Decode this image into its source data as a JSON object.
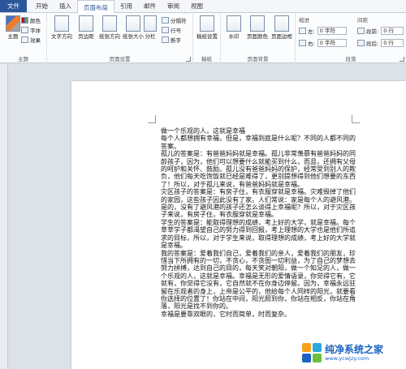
{
  "tabs": [
    "文件",
    "开始",
    "插入",
    "页面布局",
    "引用",
    "邮件",
    "审阅",
    "视图"
  ],
  "ribbon": {
    "theme_group": {
      "label": "主题",
      "theme_button": "主题",
      "colors": "颜色",
      "fonts": "字体",
      "effects": "效果"
    },
    "page_setup": {
      "label": "页面设置",
      "text_direction": "文字方向",
      "margins": "页边距",
      "orientation": "纸张方向",
      "size": "纸张大小",
      "columns": "分栏",
      "breaks": "分隔符",
      "line_numbers": "行号",
      "hyphenation": "断字"
    },
    "draft": {
      "label": "稿纸",
      "draft_settings": "稿纸设置"
    },
    "page_background": {
      "label": "页面背景",
      "watermark": "水印",
      "page_color": "页面颜色",
      "page_borders": "页面边框"
    },
    "paragraph": {
      "label": "段落",
      "indent_title": "缩进",
      "spacing_title": "间距",
      "left_label": "左:",
      "left_value": "0 字符",
      "right_label": "右:",
      "right_value": "0 字符",
      "before_label": "段前:",
      "before_value": "0 行",
      "after_label": "段后:",
      "after_value": "0 行"
    }
  },
  "document": {
    "paragraphs": [
      "做一个乐观的人，这就是幸福",
      "每个人都想拥有幸福，但是，幸福到底是什么呢？不同的人都不同的答案。",
      "孤儿的答案是：有爸爸妈妈就是幸福。孤儿非常羡慕有爸爸妈妈的同龄孩子，因为，他们可以想要什么就能买到什么，而且，还拥有父母的呵护和关怀、鼓励。孤儿没有爸爸妈妈的保护，经常受到别人的欺负，他们每天吃饱饭就已经是难得了，更别提想得到他们想要的东西了！所以，对于孤儿来说，有爸爸妈妈就是幸福。",
      "灾区孩子的答案是：有房子住，有衣服穿就是幸福。灾难毁掉了他们的家园，这些孩子因此没有了家。人们常说：家是每个人的避风港。是的，没有了避风港的孩子还怎么谈得上幸福呢？所以，对于灾区孩子来说，有房子住，有衣服穿就是幸福。",
      "学生的答案是：能取得理想的成绩，考上好的大学，就是幸福。每个莘莘学子都渴望自己的努力得到回报，考上理想的大学也是他们所追求的目标，所以，对于学生来说，取得理想的成绩，考上好的大学就是幸福。",
      "我的答案是：爱着我们自己，爱着我们的亲人，爱着我们的朋友，珍惜当下所拥有的一切，不贪心，不贪图一切利益，为了自己的梦想去努力拼搏，达到自己的目的，每天笑对朝阳，做一个知足的人，做一个乐观的人，这就是幸福。幸福是无形的爱情语录，你觉得它有，它就有，你觉得它没有，它自然就不在你身边停留。因为，幸福永远驻留在乐观者的身上，上帝是公平的，他给每个人同样的阳光，就要看你选择的位置了！你站在中间，阳光照到你，你站在相反，你站在角落，阳光是找不到你的。",
      "幸福是要靠双眼的，它时而简单，时而复杂。"
    ]
  },
  "watermark_site": {
    "title": "纯净系统之家",
    "url": "www.ycwjzy.com"
  },
  "colors": {
    "file_tab": "#2b579a",
    "accent": "#1c63c2"
  }
}
